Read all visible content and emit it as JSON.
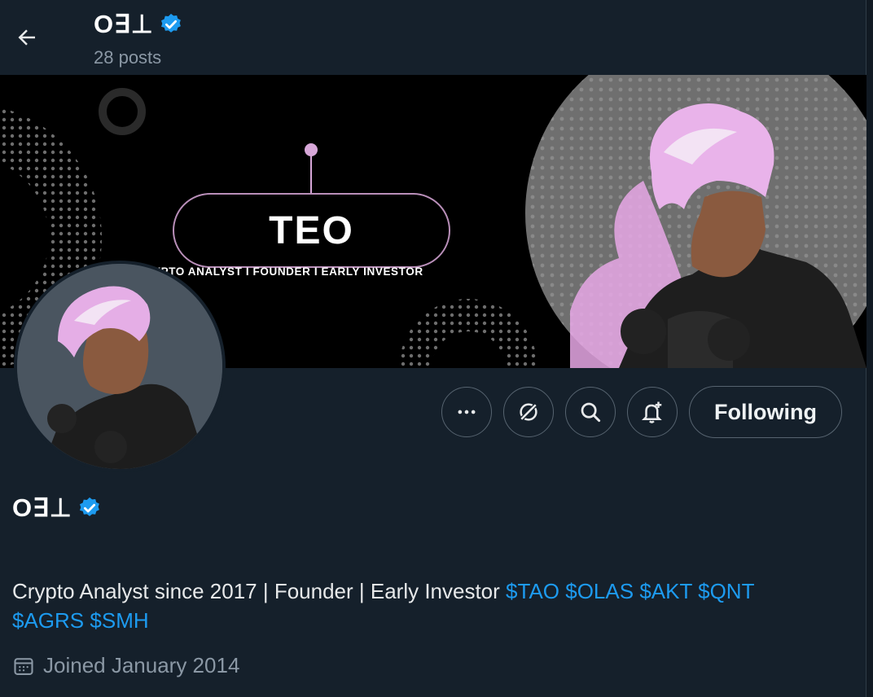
{
  "header": {
    "display_name": "O∃⊥",
    "post_count": "28 posts"
  },
  "banner": {
    "logo_text": "TEO",
    "tagline": "YPTO ANALYST I FOUNDER I EARLY INVESTOR"
  },
  "actions": {
    "following_label": "Following"
  },
  "profile": {
    "display_name": "O∃⊥",
    "bio_text": "Crypto Analyst since 2017 | Founder | Early Investor ",
    "cashtags": [
      "$TAO",
      "$OLAS",
      "$AKT",
      "$QNT",
      "$AGRS",
      "$SMH"
    ],
    "joined": "Joined January 2014"
  },
  "colors": {
    "background": "#15202b",
    "accent": "#1d9bf0",
    "verified": "#1d9bf0",
    "muted_text": "#8b98a5",
    "hair_pink": "#e7a8e6"
  },
  "icons": [
    "back-arrow-icon",
    "verified-badge-icon",
    "more-icon",
    "grok-icon",
    "search-icon",
    "notification-bell-icon",
    "calendar-icon"
  ]
}
